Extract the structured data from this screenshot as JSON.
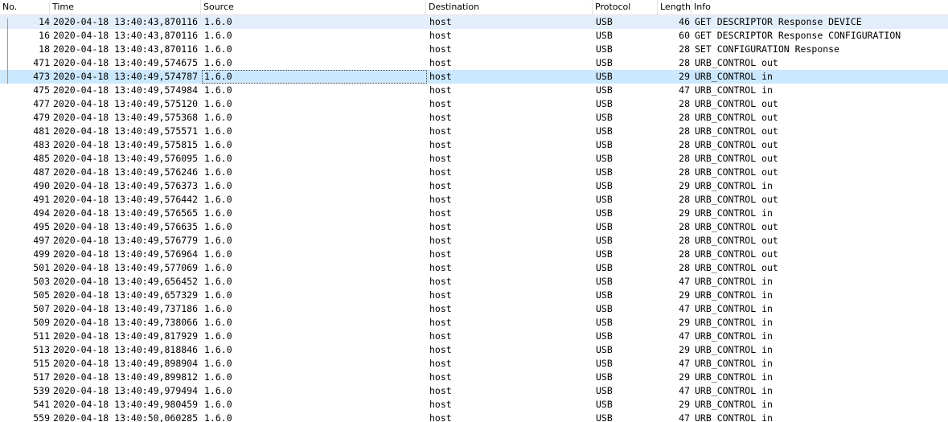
{
  "columns": {
    "no": "No.",
    "time": "Time",
    "source": "Source",
    "destination": "Destination",
    "protocol": "Protocol",
    "length": "Length",
    "info": "Info"
  },
  "sort_indicator": "^",
  "colors": {
    "selected_row": "#cce8ff",
    "related_row": "#e3eefb"
  },
  "rows": [
    {
      "no": "14",
      "time": "2020-04-18 13:40:43,870116",
      "source": "1.6.0",
      "destination": "host",
      "protocol": "USB",
      "length": "46",
      "info": "GET DESCRIPTOR Response DEVICE",
      "state": "related"
    },
    {
      "no": "16",
      "time": "2020-04-18 13:40:43,870116",
      "source": "1.6.0",
      "destination": "host",
      "protocol": "USB",
      "length": "60",
      "info": "GET DESCRIPTOR Response CONFIGURATION",
      "state": ""
    },
    {
      "no": "18",
      "time": "2020-04-18 13:40:43,870116",
      "source": "1.6.0",
      "destination": "host",
      "protocol": "USB",
      "length": "28",
      "info": "SET CONFIGURATION Response",
      "state": ""
    },
    {
      "no": "471",
      "time": "2020-04-18 13:40:49,574675",
      "source": "1.6.0",
      "destination": "host",
      "protocol": "USB",
      "length": "28",
      "info": "URB_CONTROL out",
      "state": ""
    },
    {
      "no": "473",
      "time": "2020-04-18 13:40:49,574787",
      "source": "1.6.0",
      "destination": "host",
      "protocol": "USB",
      "length": "29",
      "info": "URB_CONTROL in",
      "state": "selected"
    },
    {
      "no": "475",
      "time": "2020-04-18 13:40:49,574984",
      "source": "1.6.0",
      "destination": "host",
      "protocol": "USB",
      "length": "47",
      "info": "URB_CONTROL in",
      "state": ""
    },
    {
      "no": "477",
      "time": "2020-04-18 13:40:49,575120",
      "source": "1.6.0",
      "destination": "host",
      "protocol": "USB",
      "length": "28",
      "info": "URB_CONTROL out",
      "state": ""
    },
    {
      "no": "479",
      "time": "2020-04-18 13:40:49,575368",
      "source": "1.6.0",
      "destination": "host",
      "protocol": "USB",
      "length": "28",
      "info": "URB_CONTROL out",
      "state": ""
    },
    {
      "no": "481",
      "time": "2020-04-18 13:40:49,575571",
      "source": "1.6.0",
      "destination": "host",
      "protocol": "USB",
      "length": "28",
      "info": "URB_CONTROL out",
      "state": ""
    },
    {
      "no": "483",
      "time": "2020-04-18 13:40:49,575815",
      "source": "1.6.0",
      "destination": "host",
      "protocol": "USB",
      "length": "28",
      "info": "URB_CONTROL out",
      "state": ""
    },
    {
      "no": "485",
      "time": "2020-04-18 13:40:49,576095",
      "source": "1.6.0",
      "destination": "host",
      "protocol": "USB",
      "length": "28",
      "info": "URB_CONTROL out",
      "state": ""
    },
    {
      "no": "487",
      "time": "2020-04-18 13:40:49,576246",
      "source": "1.6.0",
      "destination": "host",
      "protocol": "USB",
      "length": "28",
      "info": "URB_CONTROL out",
      "state": ""
    },
    {
      "no": "490",
      "time": "2020-04-18 13:40:49,576373",
      "source": "1.6.0",
      "destination": "host",
      "protocol": "USB",
      "length": "29",
      "info": "URB_CONTROL in",
      "state": ""
    },
    {
      "no": "491",
      "time": "2020-04-18 13:40:49,576442",
      "source": "1.6.0",
      "destination": "host",
      "protocol": "USB",
      "length": "28",
      "info": "URB_CONTROL out",
      "state": ""
    },
    {
      "no": "494",
      "time": "2020-04-18 13:40:49,576565",
      "source": "1.6.0",
      "destination": "host",
      "protocol": "USB",
      "length": "29",
      "info": "URB_CONTROL in",
      "state": ""
    },
    {
      "no": "495",
      "time": "2020-04-18 13:40:49,576635",
      "source": "1.6.0",
      "destination": "host",
      "protocol": "USB",
      "length": "28",
      "info": "URB_CONTROL out",
      "state": ""
    },
    {
      "no": "497",
      "time": "2020-04-18 13:40:49,576779",
      "source": "1.6.0",
      "destination": "host",
      "protocol": "USB",
      "length": "28",
      "info": "URB_CONTROL out",
      "state": ""
    },
    {
      "no": "499",
      "time": "2020-04-18 13:40:49,576964",
      "source": "1.6.0",
      "destination": "host",
      "protocol": "USB",
      "length": "28",
      "info": "URB_CONTROL out",
      "state": ""
    },
    {
      "no": "501",
      "time": "2020-04-18 13:40:49,577069",
      "source": "1.6.0",
      "destination": "host",
      "protocol": "USB",
      "length": "28",
      "info": "URB_CONTROL out",
      "state": ""
    },
    {
      "no": "503",
      "time": "2020-04-18 13:40:49,656452",
      "source": "1.6.0",
      "destination": "host",
      "protocol": "USB",
      "length": "47",
      "info": "URB_CONTROL in",
      "state": ""
    },
    {
      "no": "505",
      "time": "2020-04-18 13:40:49,657329",
      "source": "1.6.0",
      "destination": "host",
      "protocol": "USB",
      "length": "29",
      "info": "URB_CONTROL in",
      "state": ""
    },
    {
      "no": "507",
      "time": "2020-04-18 13:40:49,737186",
      "source": "1.6.0",
      "destination": "host",
      "protocol": "USB",
      "length": "47",
      "info": "URB_CONTROL in",
      "state": ""
    },
    {
      "no": "509",
      "time": "2020-04-18 13:40:49,738066",
      "source": "1.6.0",
      "destination": "host",
      "protocol": "USB",
      "length": "29",
      "info": "URB_CONTROL in",
      "state": ""
    },
    {
      "no": "511",
      "time": "2020-04-18 13:40:49,817929",
      "source": "1.6.0",
      "destination": "host",
      "protocol": "USB",
      "length": "47",
      "info": "URB_CONTROL in",
      "state": ""
    },
    {
      "no": "513",
      "time": "2020-04-18 13:40:49,818846",
      "source": "1.6.0",
      "destination": "host",
      "protocol": "USB",
      "length": "29",
      "info": "URB_CONTROL in",
      "state": ""
    },
    {
      "no": "515",
      "time": "2020-04-18 13:40:49,898904",
      "source": "1.6.0",
      "destination": "host",
      "protocol": "USB",
      "length": "47",
      "info": "URB_CONTROL in",
      "state": ""
    },
    {
      "no": "517",
      "time": "2020-04-18 13:40:49,899812",
      "source": "1.6.0",
      "destination": "host",
      "protocol": "USB",
      "length": "29",
      "info": "URB_CONTROL in",
      "state": ""
    },
    {
      "no": "539",
      "time": "2020-04-18 13:40:49,979494",
      "source": "1.6.0",
      "destination": "host",
      "protocol": "USB",
      "length": "47",
      "info": "URB_CONTROL in",
      "state": ""
    },
    {
      "no": "541",
      "time": "2020-04-18 13:40:49,980459",
      "source": "1.6.0",
      "destination": "host",
      "protocol": "USB",
      "length": "29",
      "info": "URB_CONTROL in",
      "state": ""
    },
    {
      "no": "559",
      "time": "2020-04-18 13:40:50,060285",
      "source": "1.6.0",
      "destination": "host",
      "protocol": "USB",
      "length": "47",
      "info": "URB_CONTROL in",
      "state": ""
    }
  ]
}
